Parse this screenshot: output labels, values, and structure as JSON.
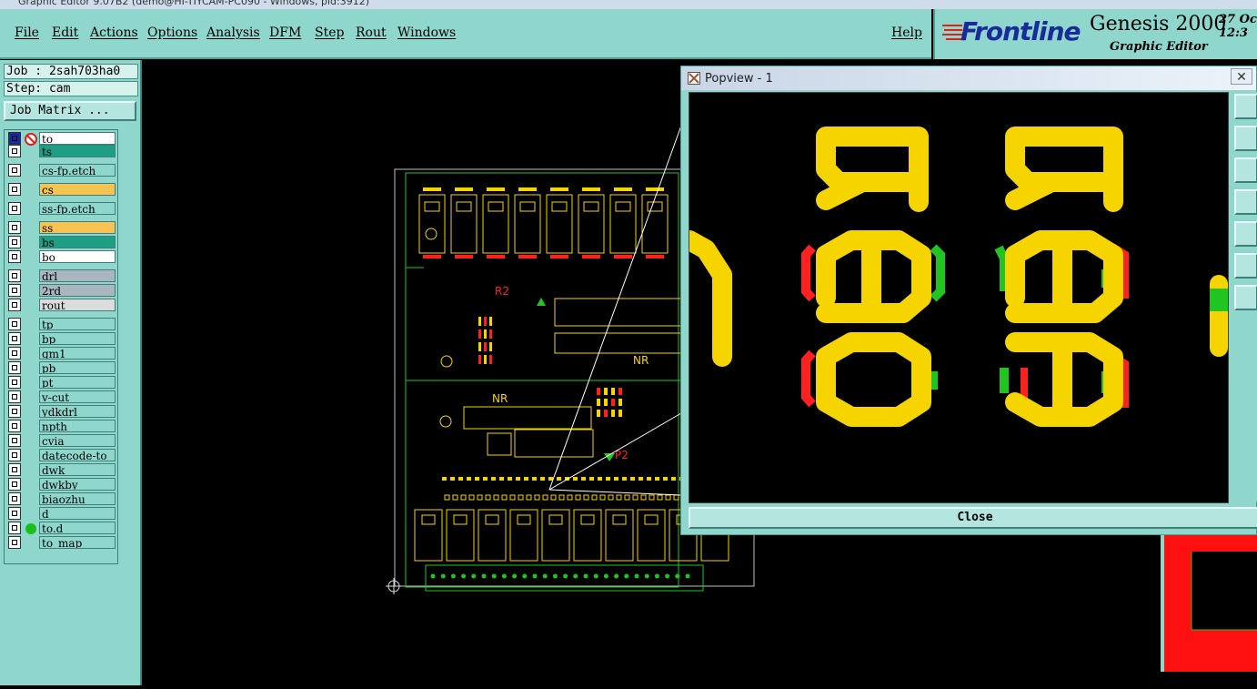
{
  "window_title": "Graphic Editor 9.07B2 (demo@HI-TIYCAM-PC090 - Windows, pid:3912)",
  "menu": [
    "File",
    "Edit",
    "Actions",
    "Options",
    "Analysis",
    "DFM",
    "Step",
    "Rout",
    "Windows"
  ],
  "help_label": "Help",
  "brand": {
    "logo": "Frontline",
    "product": "Genesis 2000",
    "subtitle": "Graphic Editor",
    "date_line1": "27 Oc",
    "date_line2": "12:3"
  },
  "job": {
    "job_line": "Job : 2sah703ha0",
    "step_line": "Step: cam",
    "matrix_button": "Job Matrix ..."
  },
  "layers": [
    {
      "name": "to",
      "color": "#ffffff"
    },
    {
      "name": "ts",
      "color": "#1f9e86"
    },
    {
      "name": "cs-fp.etch",
      "color": "#8fd6cc"
    },
    {
      "name": "cs",
      "color": "#f6c454"
    },
    {
      "name": "ss-fp.etch",
      "color": "#8fd6cc"
    },
    {
      "name": "ss",
      "color": "#f6c454"
    },
    {
      "name": "bs",
      "color": "#1f9e86"
    },
    {
      "name": "bo",
      "color": "#ffffff"
    },
    {
      "name": "drl",
      "color": "#a9b6c0"
    },
    {
      "name": "2rd",
      "color": "#a9b6c0"
    },
    {
      "name": "rout",
      "color": "#dcdcdc"
    },
    {
      "name": "tp",
      "color": "#8fd6cc"
    },
    {
      "name": "bp",
      "color": "#8fd6cc"
    },
    {
      "name": "gm1",
      "color": "#8fd6cc"
    },
    {
      "name": "pb",
      "color": "#8fd6cc"
    },
    {
      "name": "pt",
      "color": "#8fd6cc"
    },
    {
      "name": "v-cut",
      "color": "#8fd6cc"
    },
    {
      "name": "ydkdrl",
      "color": "#8fd6cc"
    },
    {
      "name": "npth",
      "color": "#8fd6cc"
    },
    {
      "name": "cvia",
      "color": "#8fd6cc"
    },
    {
      "name": "datecode-to",
      "color": "#8fd6cc"
    },
    {
      "name": "dwk",
      "color": "#8fd6cc"
    },
    {
      "name": "dwkby",
      "color": "#8fd6cc"
    },
    {
      "name": "biaozhu",
      "color": "#8fd6cc"
    },
    {
      "name": "d",
      "color": "#8fd6cc"
    },
    {
      "name": "to.d",
      "color": "#8fd6cc"
    },
    {
      "name": "to_map",
      "color": "#8fd6cc"
    }
  ],
  "popview": {
    "title": "Popview - 1",
    "close_label": "Close",
    "close_x": "✕"
  },
  "zoom_text": {
    "left": "R30",
    "right": "R33"
  },
  "colors": {
    "panel": "#8fd6cc",
    "silkscreen": "#f5d400",
    "copper_red": "#ff2020",
    "copper_green": "#22c422",
    "board_outline": "#22c422"
  }
}
